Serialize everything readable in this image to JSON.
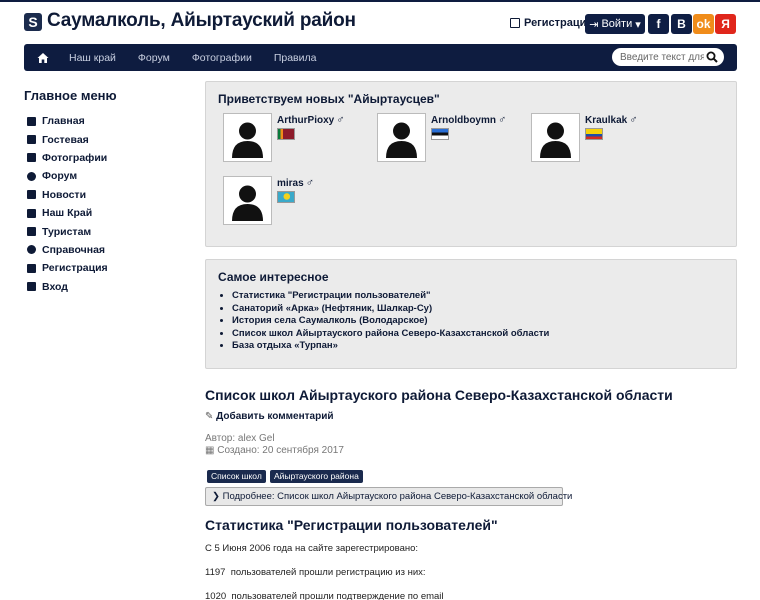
{
  "header": {
    "logo_letter": "S",
    "site_title": "Саумалколь, Айыртауский район",
    "register_label": "Регистрация",
    "login_label": "Войти",
    "social": [
      {
        "icon": "facebook-icon",
        "glyph": "f",
        "color": "#0f1e44"
      },
      {
        "icon": "vk-icon",
        "glyph": "B",
        "color": "#0f1e44"
      },
      {
        "icon": "odnoklassniki-icon",
        "glyph": "ok",
        "color": "#f08c1a"
      },
      {
        "icon": "yandex-icon",
        "glyph": "Я",
        "color": "#e0261b"
      }
    ]
  },
  "nav": {
    "items": [
      "Наш край",
      "Форум",
      "Фотографии",
      "Правила"
    ],
    "search_placeholder": "Введите текст для п"
  },
  "sidebar": {
    "title": "Главное меню",
    "items": [
      {
        "label": "Главная",
        "icon": "home-icon"
      },
      {
        "label": "Гостевая",
        "icon": "edit-icon"
      },
      {
        "label": "Фотографии",
        "icon": "camera-icon"
      },
      {
        "label": "Форум",
        "icon": "comments-icon"
      },
      {
        "label": "Новости",
        "icon": "news-icon"
      },
      {
        "label": "Наш Край",
        "icon": "map-icon"
      },
      {
        "label": "Туристам",
        "icon": "road-icon"
      },
      {
        "label": "Справочная",
        "icon": "info-icon"
      },
      {
        "label": "Регистрация",
        "icon": "edit-icon"
      },
      {
        "label": "Вход",
        "icon": "sign-in-icon"
      }
    ]
  },
  "welcome": {
    "title": "Приветствуем новых \"Айыртаусцев\"",
    "users": [
      {
        "name": "ArthurPioxy",
        "gender_symbol": "♂",
        "flag": "sri-lanka-flag"
      },
      {
        "name": "Arnoldboymn",
        "gender_symbol": "♂",
        "flag": "estonia-flag"
      },
      {
        "name": "Kraulkak",
        "gender_symbol": "♂",
        "flag": "ecuador-flag"
      },
      {
        "name": "miras",
        "gender_symbol": "♂",
        "flag": "kazakhstan-flag"
      }
    ]
  },
  "interesting": {
    "title": "Самое интересное",
    "items": [
      "Статистика \"Регистрации пользователей\"",
      "Санаторий «Арка» (Нефтяник, Шалкар-Су)",
      "История села Саумалколь (Володарское)",
      "Список школ Айыртауского района Северо-Казахстанской области",
      "База отдыха «Турпан»"
    ]
  },
  "article": {
    "title": "Список школ Айыртауского района Северо-Казахстанской области",
    "add_comment": "Добавить комментарий",
    "author": "Автор: alex Gel",
    "created": "Создано: 20 сентября 2017",
    "tags": [
      "Список школ",
      "Айыртауского района"
    ],
    "more_button": "Подробнее: Список школ Айыртауского района Северо-Казахстанской области"
  },
  "stats": {
    "title": "Статистика \"Регистрации пользователей\"",
    "lines": [
      "С 5 Июня 2006 года на сайте зарегестрировано:",
      "1197  пользователей прошли регистрацию из них:",
      "1020  пользователей прошли подтверждение по email"
    ]
  }
}
